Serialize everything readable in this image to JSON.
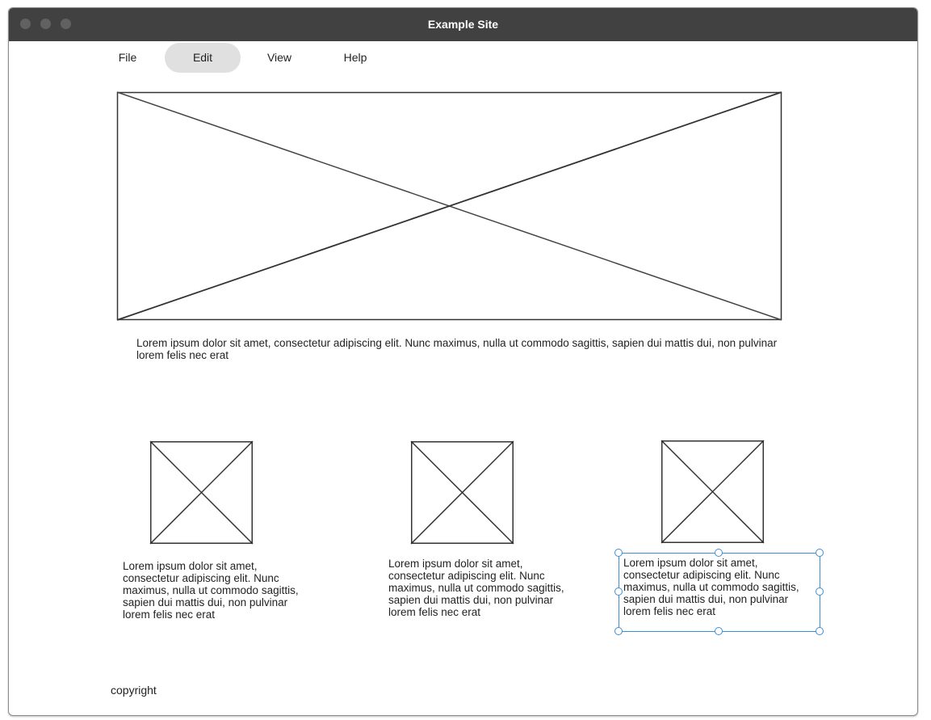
{
  "window": {
    "title": "Example Site"
  },
  "menu": {
    "items": [
      {
        "label": "File",
        "active": false
      },
      {
        "label": "Edit",
        "active": true
      },
      {
        "label": "View",
        "active": false
      },
      {
        "label": "Help",
        "active": false
      }
    ]
  },
  "hero": {
    "caption": "Lorem ipsum dolor sit amet, consectetur adipiscing elit. Nunc maximus, nulla ut commodo sagittis, sapien dui mattis dui, non pulvinar lorem felis nec erat"
  },
  "cards": [
    {
      "text": "Lorem ipsum dolor sit amet, consectetur adipiscing elit. Nunc maximus, nulla ut commodo sagittis, sapien dui mattis dui, non pulvinar lorem felis nec erat"
    },
    {
      "text": "Lorem ipsum dolor sit amet, consectetur adipiscing elit. Nunc maximus, nulla ut commodo sagittis, sapien dui mattis dui, non pulvinar lorem felis nec erat"
    },
    {
      "text": "Lorem ipsum dolor sit amet, consectetur adipiscing elit. Nunc maximus, nulla ut commodo sagittis, sapien dui mattis dui, non pulvinar lorem felis nec erat",
      "selected": true
    }
  ],
  "footer": {
    "copyright": "copyright"
  },
  "colors": {
    "titlebar": "#414141",
    "selection": "#3d8fd6",
    "active_menu": "#e0e0e0"
  }
}
